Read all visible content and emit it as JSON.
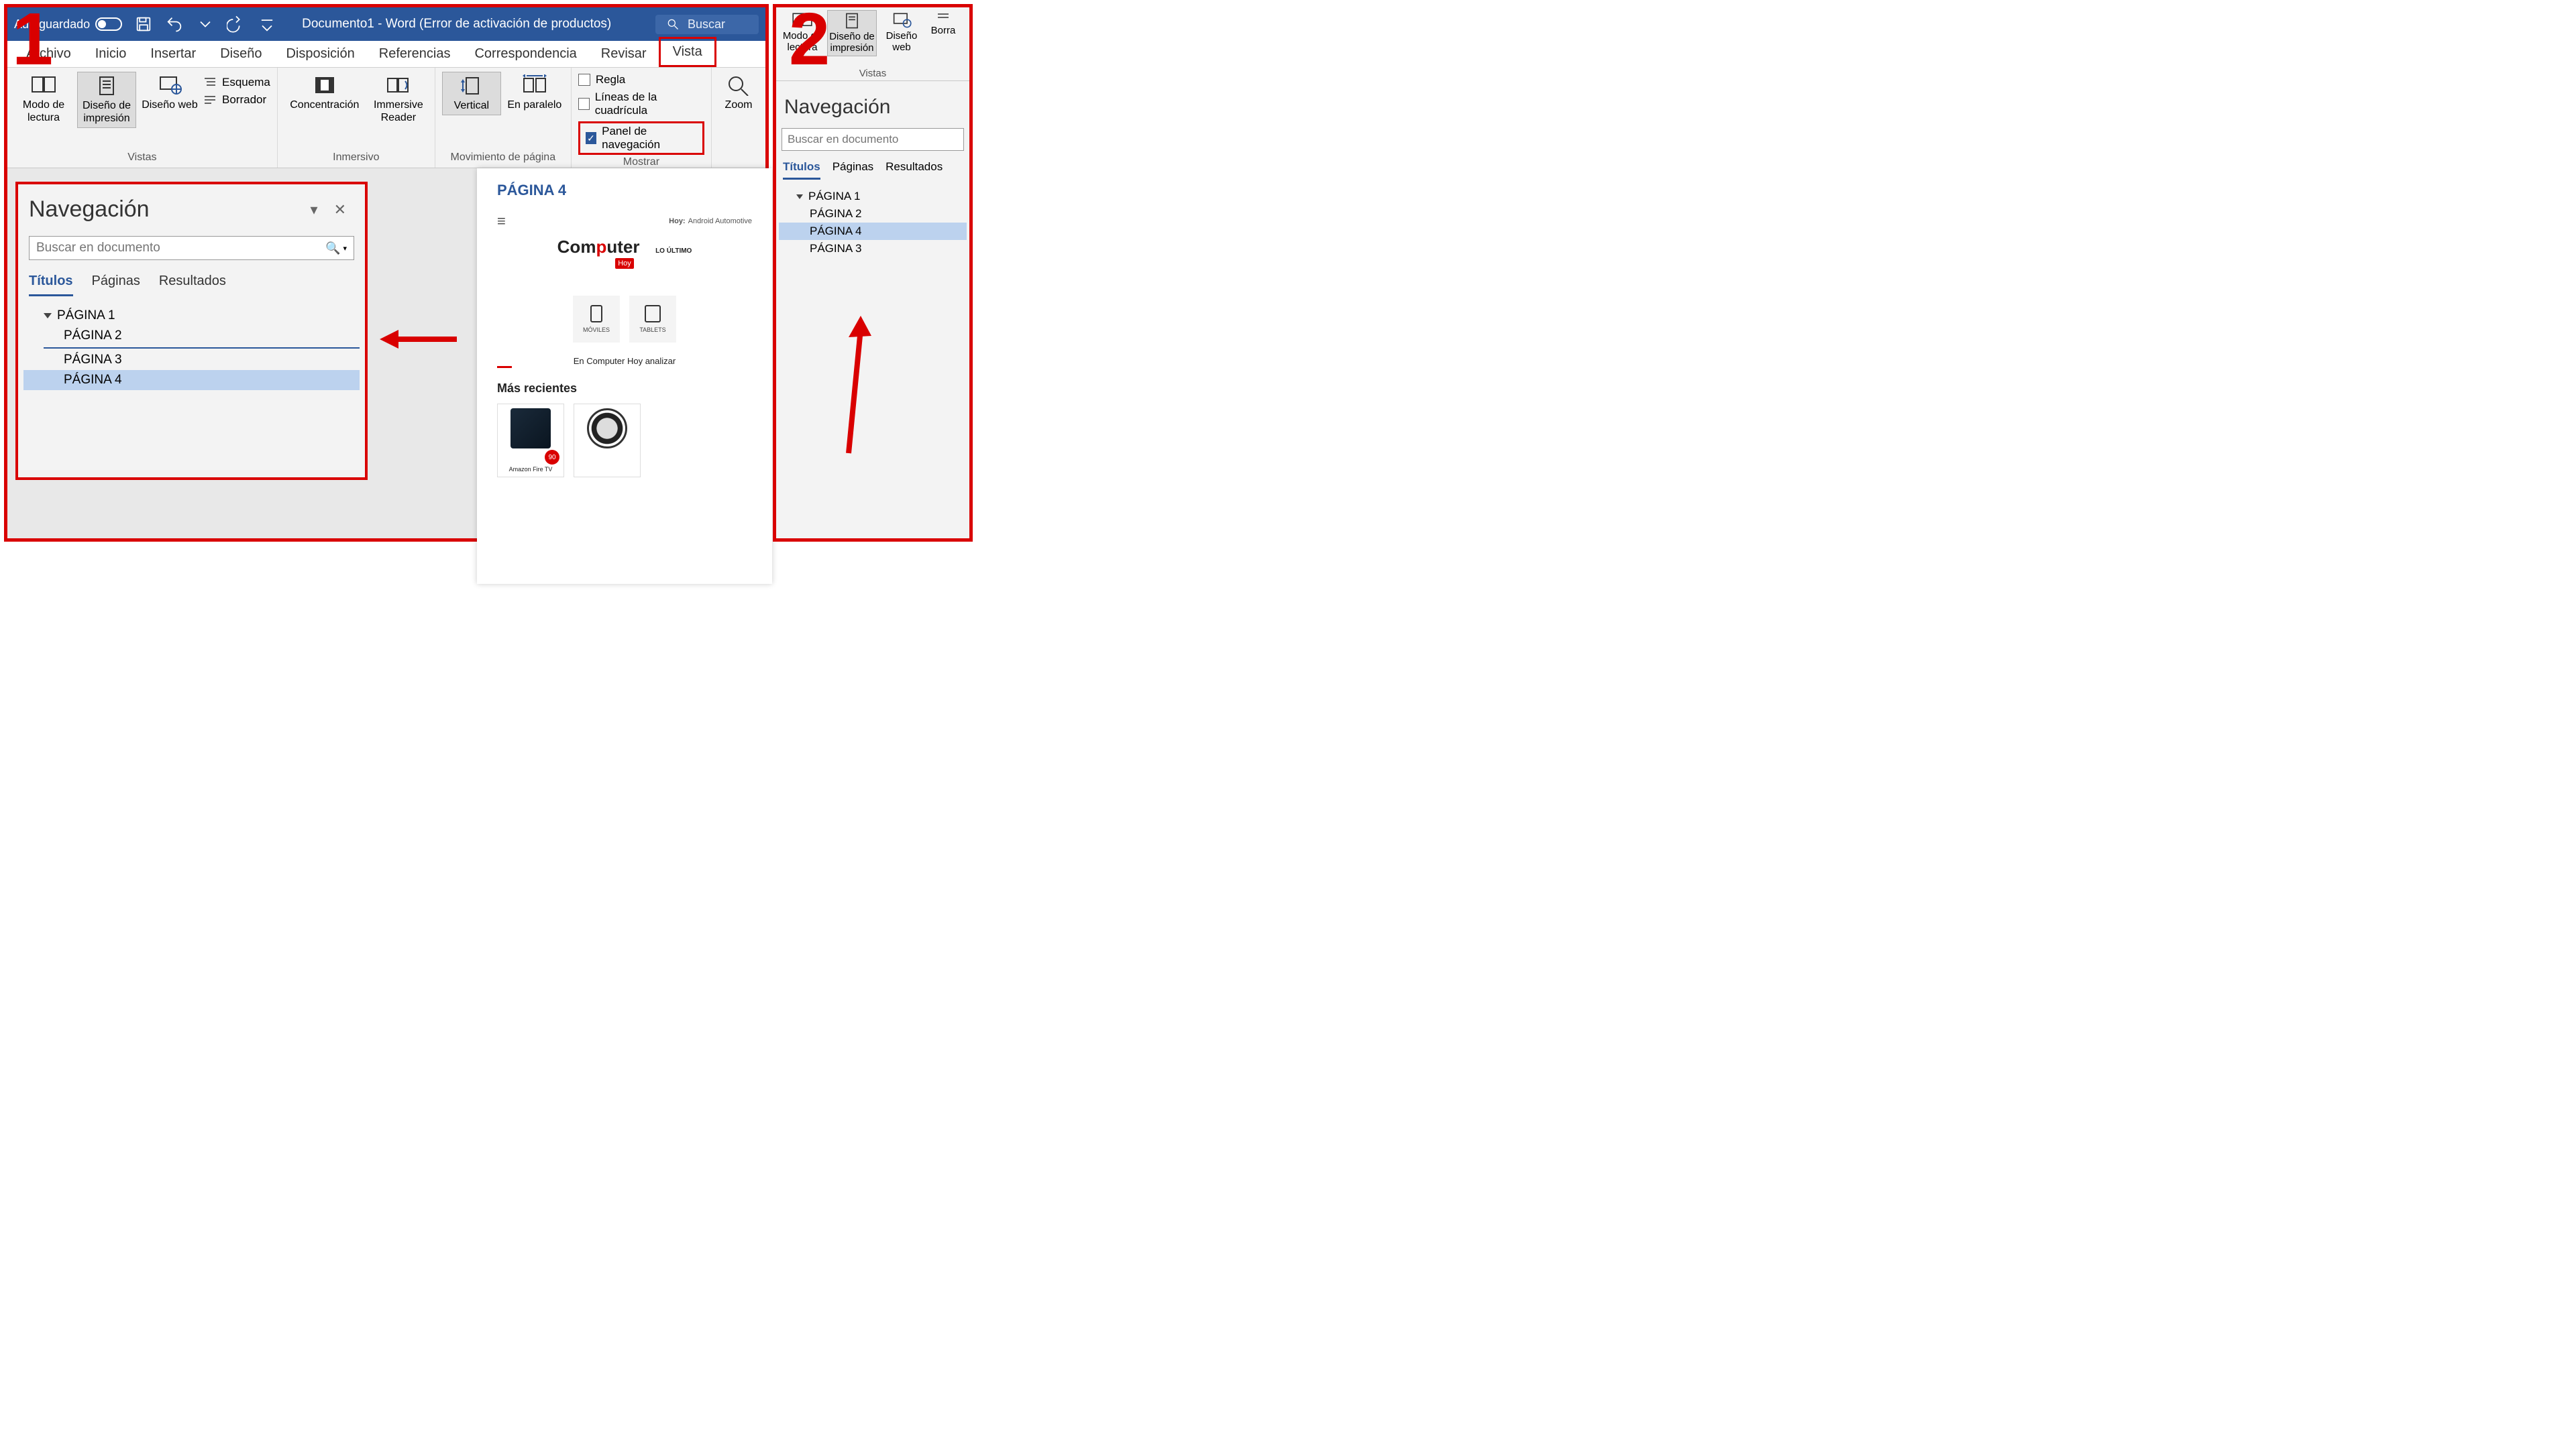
{
  "titlebar": {
    "autosave_label": "Autoguardado",
    "doc_title": "Documento1  -  Word (Error de activación de productos)",
    "search_placeholder": "Buscar"
  },
  "tabs": {
    "archivo": "Archivo",
    "inicio": "Inicio",
    "insertar": "Insertar",
    "diseno": "Diseño",
    "disposicion": "Disposición",
    "referencias": "Referencias",
    "correspondencia": "Correspondencia",
    "revisar": "Revisar",
    "vista": "Vista"
  },
  "ribbon": {
    "vistas": {
      "group_label": "Vistas",
      "modo_lectura": "Modo de lectura",
      "diseno_impresion": "Diseño de impresión",
      "diseno_web": "Diseño web",
      "esquema": "Esquema",
      "borrador": "Borrador"
    },
    "inmersivo": {
      "group_label": "Inmersivo",
      "concentracion": "Concentración",
      "immersive": "Immersive Reader"
    },
    "mov_pagina": {
      "group_label": "Movimiento de página",
      "vertical": "Vertical",
      "paralelo": "En paralelo"
    },
    "mostrar": {
      "group_label": "Mostrar",
      "regla": "Regla",
      "cuadricula": "Líneas de la cuadrícula",
      "panel_nav": "Panel de navegación"
    },
    "zoom": {
      "label": "Zoom"
    }
  },
  "nav_pane": {
    "title": "Navegación",
    "search_placeholder": "Buscar en documento",
    "tabs": {
      "titulos": "Títulos",
      "paginas": "Páginas",
      "resultados": "Resultados"
    },
    "items": [
      {
        "label": "PÁGINA 1",
        "level": 1
      },
      {
        "label": "PÁGINA 2",
        "level": 2
      },
      {
        "label": "PÁGINA 3",
        "level": 2
      },
      {
        "label": "PÁGINA 4",
        "level": 2,
        "selected": true
      }
    ]
  },
  "document": {
    "heading": "PÁGINA 4",
    "hoy_label": "Hoy:",
    "hoy_text": "Android Automotive",
    "logo1": "Com",
    "logo2": "p",
    "logo3": "uter",
    "logo_badge": "Hoy",
    "lo_ultimo": "LO ÚLTIMO",
    "card_moviles": "MÓVILES",
    "card_tablets": "TABLETS",
    "subline": "En Computer Hoy analizar",
    "mas_recientes": "Más recientes",
    "badge_score": "90",
    "prod1": "Amazon Fire TV"
  },
  "panel2": {
    "mini_ribbon": {
      "modo_lectura": "Modo de lectura",
      "diseno_impresion": "Diseño de impresión",
      "diseno_web": "Diseño web",
      "borra": "Borra",
      "group_label": "Vistas"
    },
    "nav": {
      "title": "Navegación",
      "search_placeholder": "Buscar en documento",
      "tabs": {
        "titulos": "Títulos",
        "paginas": "Páginas",
        "resultados": "Resultados"
      },
      "items": [
        {
          "label": "PÁGINA 1",
          "level": 1
        },
        {
          "label": "PÁGINA 2",
          "level": 2
        },
        {
          "label": "PÁGINA 4",
          "level": 2,
          "selected": true
        },
        {
          "label": "PÁGINA 3",
          "level": 2
        }
      ]
    }
  },
  "annotations": {
    "num1": "1",
    "num2": "2"
  }
}
